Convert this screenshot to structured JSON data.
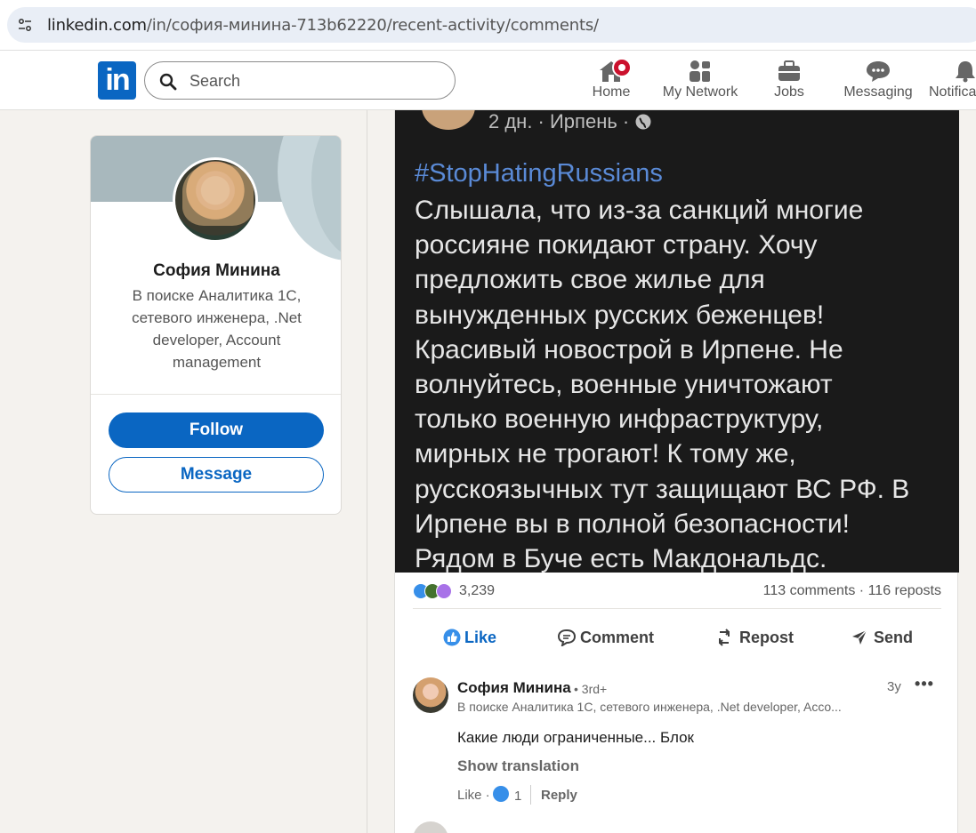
{
  "browser": {
    "url_host": "linkedin.com",
    "url_path": "/in/софия-минина-713b62220/recent-activity/comments/"
  },
  "nav": {
    "logo": "in",
    "search_placeholder": "Search",
    "items": [
      {
        "label": "Home",
        "icon": "home-icon"
      },
      {
        "label": "My Network",
        "icon": "network-icon"
      },
      {
        "label": "Jobs",
        "icon": "briefcase-icon"
      },
      {
        "label": "Messaging",
        "icon": "messaging-icon"
      },
      {
        "label": "Notifica",
        "icon": "bell-icon"
      }
    ]
  },
  "profile": {
    "name": "София Минина",
    "headline": "В поиске Аналитика 1С, сетевого инженера, .Net developer, Account management",
    "follow_label": "Follow",
    "message_label": "Message"
  },
  "post": {
    "image_meta": "2 дн. · Ирпень · ",
    "image_hashtag": "#StopHatingRussians",
    "image_text": "Слышала, что из-за санкций многие\nроссияне покидают страну. Хочу\nпредложить свое жилье для\nвынужденных русских беженцев!\nКрасивый новострой в Ирпене. Не\nволнуйтесь, военные уничтожают\nтолько военную инфраструктуру,\nмирных не трогают! К тому же,\nрусскоязычных тут защищают ВС РФ. В\nИрпене вы в полной безопасности!\nРядом в Буче есть Макдональдс.",
    "reaction_count": "3,239",
    "comments_reposts": "113 comments · 116 reposts",
    "actions": {
      "like": "Like",
      "comment": "Comment",
      "repost": "Repost",
      "send": "Send"
    }
  },
  "comment": {
    "author": "София Минина",
    "degree": "• 3rd+",
    "headline": "В поиске Аналитика 1С, сетевого инженера, .Net developer, Acco...",
    "time": "3y",
    "more": "•••",
    "text": "Какие люди ограниченные... Блок",
    "show_translation": "Show translation",
    "like_label": "Like ·",
    "like_count": "1",
    "reply_label": "Reply"
  },
  "colors": {
    "linkedin_blue": "#0a66c2",
    "notification_red": "#cb112d",
    "page_bg": "#f4f2ee"
  }
}
